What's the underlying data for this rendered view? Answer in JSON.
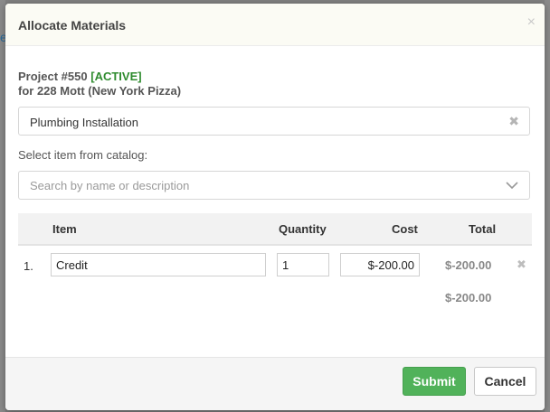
{
  "backdrop": {
    "edge_text": "e"
  },
  "modal": {
    "title": "Allocate Materials",
    "close_glyph": "×"
  },
  "project": {
    "number": "Project #550",
    "status": "[ACTIVE]",
    "for_line": "for 228 Mott (New York Pizza)"
  },
  "service": {
    "selected": "Plumbing Installation",
    "clear_glyph": "✖"
  },
  "catalog": {
    "label": "Select item from catalog:",
    "placeholder": "Search by name or description"
  },
  "table": {
    "headers": {
      "item": "Item",
      "quantity": "Quantity",
      "cost": "Cost",
      "total": "Total"
    },
    "rows": [
      {
        "num": "1.",
        "item": "Credit",
        "quantity": "1",
        "cost": "$-200.00",
        "total": "$-200.00",
        "remove_glyph": "✖"
      }
    ],
    "grand_total": "$-200.00"
  },
  "footer": {
    "submit_label": "Submit",
    "cancel_label": "Cancel"
  },
  "colors": {
    "submit_bg": "#51b25a",
    "status_green": "#2e8b2e",
    "header_bg": "#fbfbf4"
  }
}
